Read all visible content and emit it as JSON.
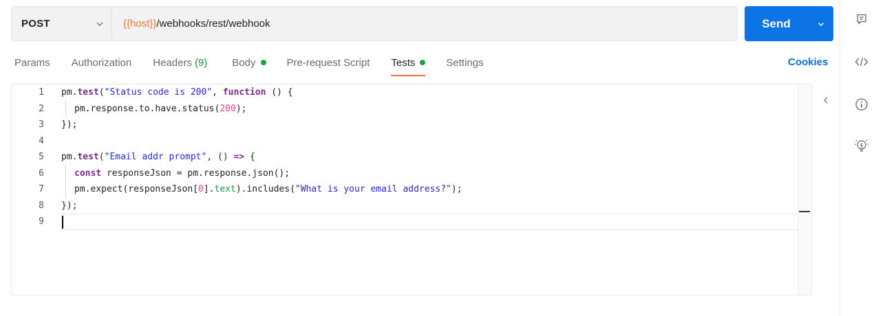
{
  "request": {
    "method": "POST",
    "url_variable": "{{host}}",
    "url_path": "/webhooks/rest/webhook",
    "send_label": "Send"
  },
  "tabs": [
    {
      "label": "Params"
    },
    {
      "label": "Authorization"
    },
    {
      "label": "Headers",
      "count": "(9)"
    },
    {
      "label": "Body",
      "has_dot": true
    },
    {
      "label": "Pre-request Script"
    },
    {
      "label": "Tests",
      "has_dot": true,
      "active": true
    },
    {
      "label": "Settings"
    }
  ],
  "cookies_label": "Cookies",
  "editor": {
    "line_numbers": [
      "1",
      "2",
      "3",
      "4",
      "5",
      "6",
      "7",
      "8",
      "9"
    ],
    "lines": [
      "pm.test(\"Status code is 200\", function () {",
      "pm.response.to.have.status(200);",
      "});",
      "",
      "pm.test(\"Email addr prompt\", () => {",
      "const responseJson = pm.response.json();",
      "pm.expect(responseJson[0].text).includes(\"What is your email address?\");",
      "});",
      ""
    ]
  },
  "icons": {
    "method_dropdown": "chevron-down-icon",
    "send_dropdown": "chevron-down-icon",
    "collapse": "chevron-left-icon",
    "rail": [
      "comment-icon",
      "code-icon",
      "info-icon",
      "lightbulb-icon"
    ]
  },
  "colors": {
    "send_button": "#0d74e6",
    "active_tab_underline": "#f26b3a",
    "url_variable": "#e8773a",
    "status_dot": "#1e9e4a"
  }
}
